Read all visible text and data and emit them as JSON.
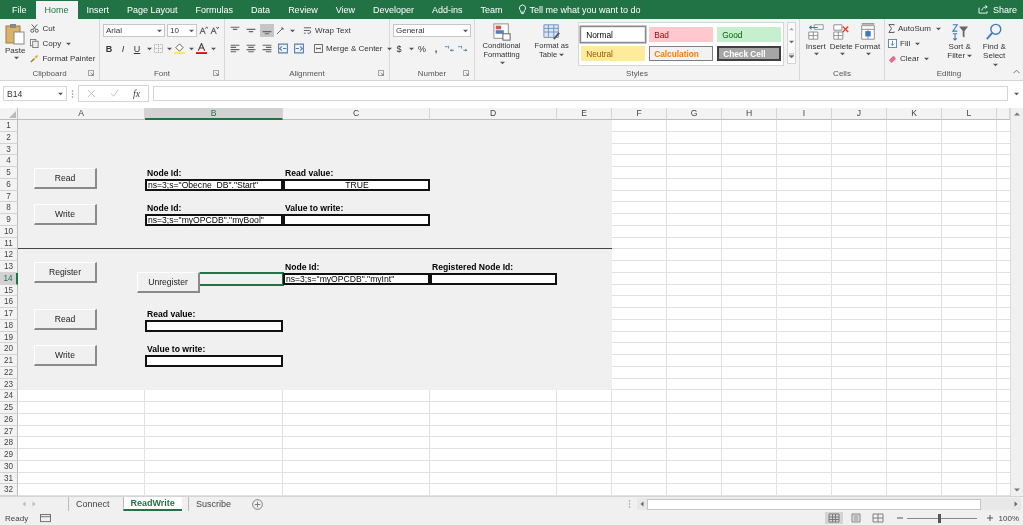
{
  "menu_tabs": [
    {
      "label": "File",
      "selected": false
    },
    {
      "label": "Home",
      "selected": true
    },
    {
      "label": "Insert",
      "selected": false
    },
    {
      "label": "Page Layout",
      "selected": false
    },
    {
      "label": "Formulas",
      "selected": false
    },
    {
      "label": "Data",
      "selected": false
    },
    {
      "label": "Review",
      "selected": false
    },
    {
      "label": "View",
      "selected": false
    },
    {
      "label": "Developer",
      "selected": false
    },
    {
      "label": "Add-ins",
      "selected": false
    },
    {
      "label": "Team",
      "selected": false
    }
  ],
  "tell_me": "Tell me what you want to do",
  "share": "Share",
  "clipboard": {
    "paste": "Paste",
    "cut": "Cut",
    "copy": "Copy",
    "format_painter": "Format Painter",
    "group": "Clipboard"
  },
  "font": {
    "name": "Arial",
    "size": "10",
    "bold": "B",
    "italic": "I",
    "underline": "U",
    "group": "Font"
  },
  "alignment": {
    "vertical": [
      {
        "kind": "top",
        "selected": false
      },
      {
        "kind": "middle",
        "selected": false
      },
      {
        "kind": "bottom",
        "selected": true
      }
    ],
    "wrap_text": "Wrap Text",
    "merge_center": "Merge & Center",
    "group": "Alignment"
  },
  "number": {
    "format": "General",
    "currency": "$",
    "percent": "%",
    "comma": ",",
    "group": "Number"
  },
  "styles": {
    "conditional_formatting": "Conditional Formatting",
    "format_as_table": "Format as Table",
    "cell_styles": [
      {
        "label": "Normal",
        "kind": "normal",
        "selected": true
      },
      {
        "label": "Bad",
        "kind": "bad",
        "selected": false
      },
      {
        "label": "Good",
        "kind": "good",
        "selected": false
      },
      {
        "label": "Neutral",
        "kind": "neutral",
        "selected": false
      },
      {
        "label": "Calculation",
        "kind": "calculation",
        "selected": false
      },
      {
        "label": "Check Cell",
        "kind": "check",
        "selected": false
      }
    ],
    "group": "Styles"
  },
  "cells": {
    "buttons": [
      "Insert",
      "Delete",
      "Format"
    ],
    "group": "Cells"
  },
  "editing": {
    "autosum": "AutoSum",
    "fill": "Fill",
    "clear": "Clear",
    "sort_filter": "Sort & Filter",
    "find_select": "Find & Select",
    "group": "Editing"
  },
  "formula_bar": {
    "name_box": "B14",
    "function_label": "fx"
  },
  "columns": [
    {
      "label": "A",
      "selected": false
    },
    {
      "label": "B",
      "selected": true
    },
    {
      "label": "C",
      "selected": false
    },
    {
      "label": "D",
      "selected": false
    },
    {
      "label": "E",
      "selected": false
    },
    {
      "label": "F",
      "selected": false
    },
    {
      "label": "G",
      "selected": false
    },
    {
      "label": "H",
      "selected": false
    },
    {
      "label": "I",
      "selected": false
    },
    {
      "label": "J",
      "selected": false
    },
    {
      "label": "K",
      "selected": false
    },
    {
      "label": "L",
      "selected": false
    }
  ],
  "rows": [
    {
      "label": "1",
      "selected": false
    },
    {
      "label": "2",
      "selected": false
    },
    {
      "label": "3",
      "selected": false
    },
    {
      "label": "4",
      "selected": false
    },
    {
      "label": "5",
      "selected": false
    },
    {
      "label": "6",
      "selected": false
    },
    {
      "label": "7",
      "selected": false
    },
    {
      "label": "8",
      "selected": false
    },
    {
      "label": "9",
      "selected": false
    },
    {
      "label": "10",
      "selected": false
    },
    {
      "label": "11",
      "selected": false
    },
    {
      "label": "12",
      "selected": false
    },
    {
      "label": "13",
      "selected": false
    },
    {
      "label": "14",
      "selected": true
    },
    {
      "label": "15",
      "selected": false
    },
    {
      "label": "16",
      "selected": false
    },
    {
      "label": "17",
      "selected": false
    },
    {
      "label": "18",
      "selected": false
    },
    {
      "label": "19",
      "selected": false
    },
    {
      "label": "20",
      "selected": false
    },
    {
      "label": "21",
      "selected": false
    },
    {
      "label": "22",
      "selected": false
    },
    {
      "label": "23",
      "selected": false
    },
    {
      "label": "24",
      "selected": false
    },
    {
      "label": "25",
      "selected": false
    },
    {
      "label": "26",
      "selected": false
    },
    {
      "label": "27",
      "selected": false
    },
    {
      "label": "28",
      "selected": false
    },
    {
      "label": "29",
      "selected": false
    },
    {
      "label": "30",
      "selected": false
    },
    {
      "label": "31",
      "selected": false
    },
    {
      "label": "32",
      "selected": false
    }
  ],
  "form": {
    "section_1": {
      "read_button": "Read",
      "write_button": "Write",
      "read_node_label": "Node Id:",
      "read_node_id": "ns=3;s=\"Obecne_DB\".\"Start\"",
      "read_value_label": "Read value:",
      "read_value": "TRUE",
      "write_node_label": "Node Id:",
      "write_node_id": "ns=3;s=\"myOPCDB\".\"myBool\"",
      "write_value_label": "Value to write:"
    },
    "section_2": {
      "register_button": "Register",
      "unregister_button": "Unregister",
      "node_label": "Node Id:",
      "node_id": "ns=3;s=\"myOPCDB\".\"myInt\"",
      "registered_label": "Registered Node Id:",
      "read_button": "Read",
      "read_value_label": "Read value:",
      "write_button": "Write",
      "write_value_label": "Value to write:"
    }
  },
  "sheet_tabs": [
    {
      "label": "Connect",
      "selected": false
    },
    {
      "label": "ReadWrite",
      "selected": true
    },
    {
      "label": "Suscribe",
      "selected": false
    }
  ],
  "status_bar": {
    "text": "Ready",
    "view_modes": [
      {
        "kind": "normal",
        "selected": true
      },
      {
        "kind": "page_layout",
        "selected": false
      },
      {
        "kind": "page_break",
        "selected": false
      }
    ],
    "zoom_slider": {
      "level": 0.47
    },
    "zoom": "100%"
  }
}
